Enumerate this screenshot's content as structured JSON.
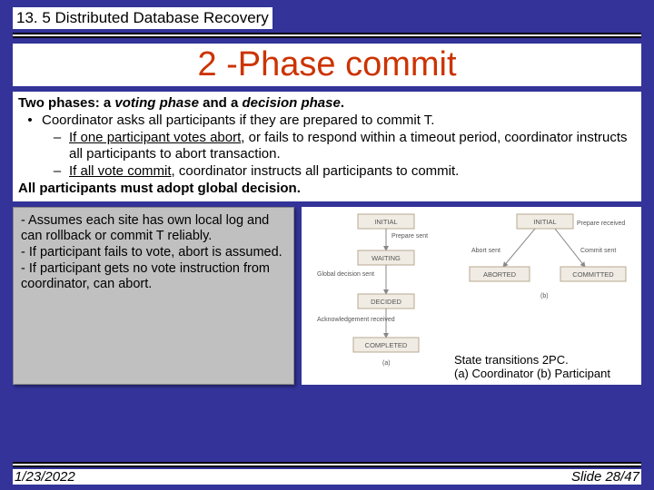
{
  "header": {
    "section": "13. 5 Distributed Database Recovery"
  },
  "title": "2 -Phase commit",
  "body": {
    "line1_a": "Two phases: a ",
    "line1_b": "voting phase",
    "line1_c": " and a ",
    "line1_d": "decision phase",
    "line1_e": ".",
    "bullet": "Coordinator asks all participants if they are prepared to commit T.",
    "sub1_a": "If one participant votes abort",
    "sub1_b": ", or fails to respond within a timeout period, coordinator instructs all participants to abort transaction.",
    "sub2_a": "If all vote commit",
    "sub2_b": ", coordinator instructs all participants to commit.",
    "last": "All participants must adopt global decision."
  },
  "notes": {
    "n1": "- Assumes each site has own local log and can rollback or commit T reliably.",
    "n2": "- If participant fails to vote, abort is assumed.",
    "n3": "- If participant gets no vote instruction from coordinator, can abort."
  },
  "diagram": {
    "initial": "INITIAL",
    "waiting": "WAITING",
    "decided": "DECIDED",
    "completed": "COMPLETED",
    "aborted": "ABORTED",
    "committed": "COMMITTED",
    "prepare_sent": "Prepare sent",
    "prepare_recv": "Prepare received",
    "global_sent": "Global decision sent",
    "abort_sent": "Abort sent",
    "commit_sent": "Commit sent",
    "ack_recv": "Acknowledgement received",
    "a": "(a)",
    "b": "(b)"
  },
  "caption": {
    "l1": "State transitions 2PC.",
    "l2": "(a) Coordinator (b) Participant"
  },
  "footer": {
    "date": "1/23/2022",
    "slide": "Slide 28/47"
  }
}
